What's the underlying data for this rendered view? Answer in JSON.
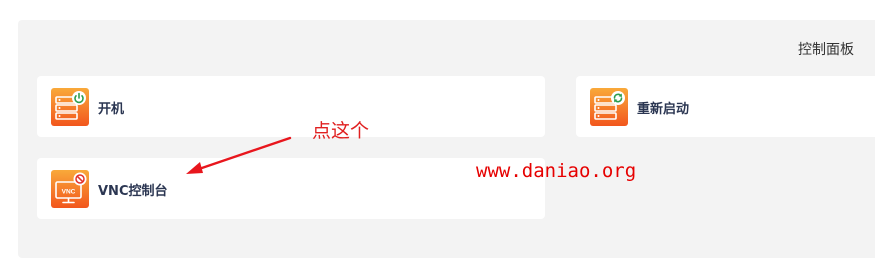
{
  "panel": {
    "title": "控制面板"
  },
  "actions": {
    "power_on": {
      "label": "开机",
      "icon": "server-power-icon"
    },
    "reboot": {
      "label": "重新启动",
      "icon": "server-refresh-icon"
    },
    "vnc": {
      "label": "VNC控制台",
      "icon": "monitor-vnc-icon"
    }
  },
  "annotations": {
    "callout": "点这个",
    "watermark": "www.daniao.org"
  },
  "colors": {
    "icon_gradient_top": "#f79a2c",
    "icon_gradient_bottom": "#f25c1e",
    "power_green": "#2e9e4f",
    "annotation_red": "#e02020",
    "label_navy": "#2b3652"
  }
}
